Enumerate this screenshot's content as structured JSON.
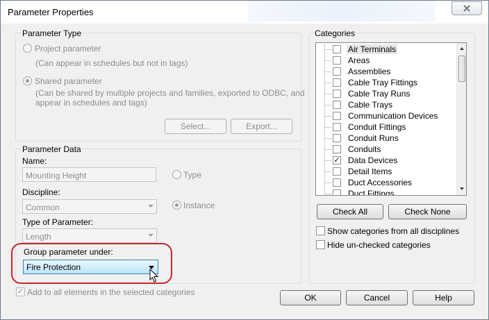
{
  "window": {
    "title": "Parameter Properties"
  },
  "parameter_type": {
    "group_label": "Parameter Type",
    "project_label": "Project parameter",
    "project_desc": "(Can appear in schedules but not in tags)",
    "shared_label": "Shared parameter",
    "shared_desc_1": "(Can be shared by multiple projects and families, exported to ODBC, and",
    "shared_desc_2": "appear in schedules and tags)",
    "select_button": "Select...",
    "export_button": "Export..."
  },
  "parameter_data": {
    "group_label": "Parameter Data",
    "name_label": "Name:",
    "name_value": "Mounting Height",
    "discipline_label": "Discipline:",
    "discipline_value": "Common",
    "type_of_param_label": "Type of Parameter:",
    "type_of_param_value": "Length",
    "group_under_label": "Group parameter under:",
    "group_under_value": "Fire Protection",
    "type_radio": "Type",
    "instance_radio": "Instance"
  },
  "add_all_label": "Add to all elements in the selected categories",
  "categories": {
    "group_label": "Categories",
    "items": [
      {
        "label": "Air Terminals",
        "checked": ""
      },
      {
        "label": "Areas",
        "checked": ""
      },
      {
        "label": "Assemblies",
        "checked": ""
      },
      {
        "label": "Cable Tray Fittings",
        "checked": ""
      },
      {
        "label": "Cable Tray Runs",
        "checked": ""
      },
      {
        "label": "Cable Trays",
        "checked": ""
      },
      {
        "label": "Communication Devices",
        "checked": ""
      },
      {
        "label": "Conduit Fittings",
        "checked": ""
      },
      {
        "label": "Conduit Runs",
        "checked": ""
      },
      {
        "label": "Conduits",
        "checked": ""
      },
      {
        "label": "Data Devices",
        "checked": "✓"
      },
      {
        "label": "Detail Items",
        "checked": ""
      },
      {
        "label": "Duct Accessories",
        "checked": ""
      },
      {
        "label": "Duct Fittings",
        "checked": ""
      }
    ],
    "check_all": "Check All",
    "check_none": "Check None",
    "show_all_disciplines": "Show categories from all disciplines",
    "hide_unchecked": "Hide un-checked categories"
  },
  "footer": {
    "ok": "OK",
    "cancel": "Cancel",
    "help": "Help"
  },
  "colors": {
    "highlight_ring": "#c8252c",
    "dropdown_active": "#bee6fd"
  }
}
